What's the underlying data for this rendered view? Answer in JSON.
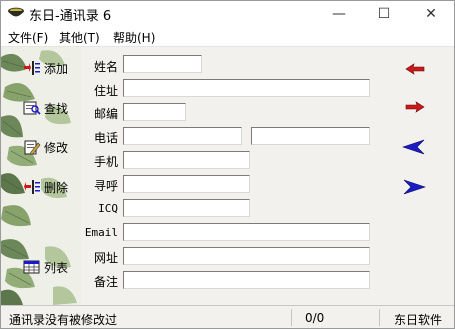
{
  "window": {
    "title": "东日-通讯录 6",
    "icon": "bowl-icon",
    "controls": {
      "minimize": "—",
      "maximize": "☐",
      "close": "✕"
    }
  },
  "menu": [
    {
      "label": "文件(F)"
    },
    {
      "label": "其他(T)"
    },
    {
      "label": "帮助(H)"
    }
  ],
  "sidebar": {
    "buttons": [
      {
        "label": "添加",
        "icon": "add-icon"
      },
      {
        "label": "查找",
        "icon": "find-icon"
      },
      {
        "label": "修改",
        "icon": "edit-icon"
      },
      {
        "label": "删除",
        "icon": "delete-icon"
      },
      {
        "label": "列表",
        "icon": "list-icon"
      }
    ]
  },
  "form": {
    "name_label": "姓名",
    "name_value": "",
    "address_label": "住址",
    "address_value": "",
    "zip_label": "邮编",
    "zip_value": "",
    "phone_label": "电话",
    "phone1_value": "",
    "phone2_value": "",
    "mobile_label": "手机",
    "mobile_value": "",
    "pager_label": "寻呼",
    "pager_value": "",
    "icq_label": "ICQ",
    "icq_value": "",
    "email_label": "Email",
    "email_value": "",
    "website_label": "网址",
    "website_value": "",
    "note_label": "备注",
    "note_value": ""
  },
  "navigation": [
    {
      "name": "first-record",
      "icon": "arrow-left-small-icon",
      "color": "#d01818"
    },
    {
      "name": "next-record",
      "icon": "arrow-right-small-icon",
      "color": "#d01818"
    },
    {
      "name": "previous-record",
      "icon": "arrow-left-large-icon",
      "color": "#1c1cc4"
    },
    {
      "name": "last-record",
      "icon": "arrow-right-large-icon",
      "color": "#1c1cc4"
    }
  ],
  "status": {
    "message": "通讯录没有被修改过",
    "counter": "0/0",
    "company": "东日软件"
  }
}
